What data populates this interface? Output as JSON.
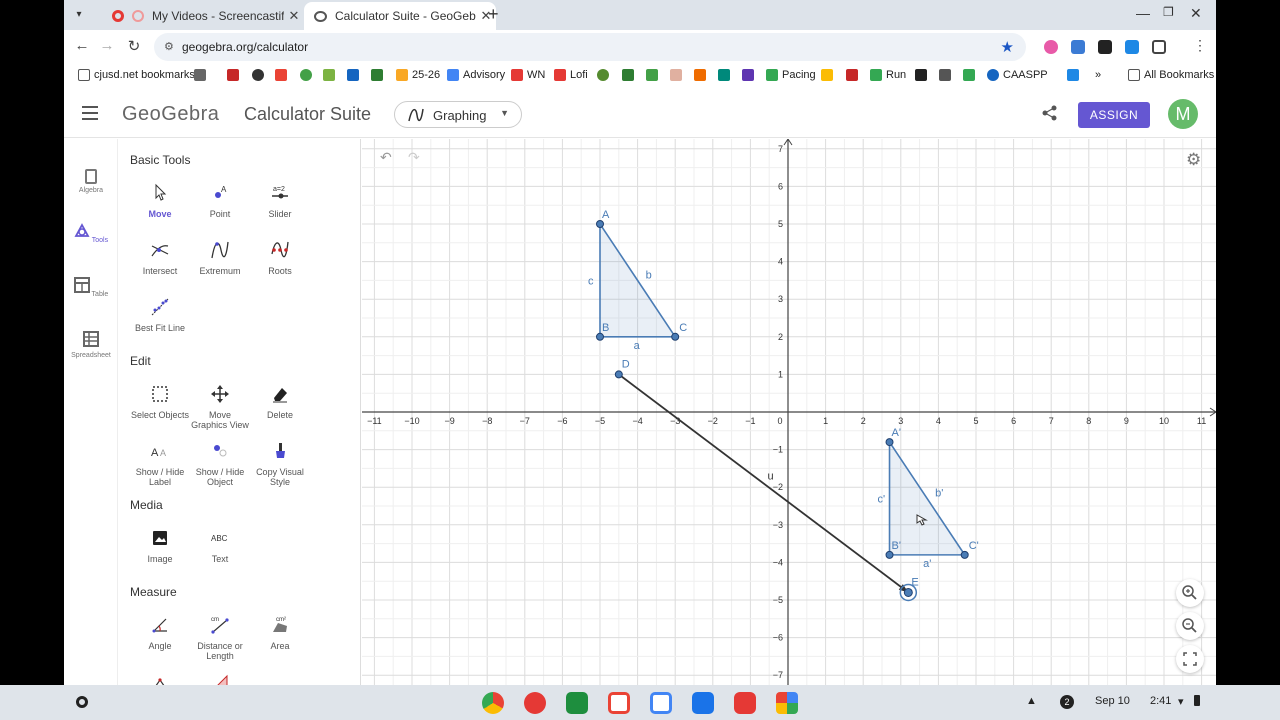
{
  "browser": {
    "tabs": [
      {
        "title": "My Videos - Screencastify",
        "active": false
      },
      {
        "title": "Calculator Suite - GeoGebra",
        "active": true
      }
    ],
    "url": "geogebra.org/calculator",
    "bookmarks": [
      "cjusd.net bookmarks",
      "25-26",
      "Advisory",
      "WN",
      "Lofi",
      "Pacing",
      "Run",
      "CAASPP"
    ],
    "all_bookmarks": "All Bookmarks",
    "overflow": "»"
  },
  "header": {
    "logo": "GeoGebra",
    "suite": "Calculator Suite",
    "app_select": "Graphing",
    "assign": "ASSIGN",
    "avatar": "M",
    "accent": "#6557d2"
  },
  "rail": [
    {
      "label": "Algebra",
      "icon": "calculator-icon",
      "active": false
    },
    {
      "label": "Tools",
      "icon": "tools-icon",
      "active": true
    },
    {
      "label": "Table",
      "icon": "table-icon",
      "active": false
    },
    {
      "label": "Spreadsheet",
      "icon": "spreadsheet-icon",
      "active": false
    }
  ],
  "tools": {
    "basic": {
      "title": "Basic Tools",
      "items": [
        {
          "l1": "Move",
          "l2": "",
          "icon": "move-arrow-icon",
          "selected": true
        },
        {
          "l1": "Point",
          "l2": "",
          "icon": "point-icon"
        },
        {
          "l1": "Slider",
          "l2": "",
          "icon": "slider-icon"
        },
        {
          "l1": "Intersect",
          "l2": "",
          "icon": "intersect-icon"
        },
        {
          "l1": "Extremum",
          "l2": "",
          "icon": "extremum-icon"
        },
        {
          "l1": "Roots",
          "l2": "",
          "icon": "roots-icon"
        },
        {
          "l1": "Best Fit Line",
          "l2": "",
          "icon": "best-fit-line-icon"
        }
      ]
    },
    "edit": {
      "title": "Edit",
      "items": [
        {
          "l1": "Select Objects",
          "l2": "",
          "icon": "select-objects-icon"
        },
        {
          "l1": "Move",
          "l2": "Graphics View",
          "icon": "move-graphics-icon"
        },
        {
          "l1": "Delete",
          "l2": "",
          "icon": "eraser-icon"
        },
        {
          "l1": "Show / Hide",
          "l2": "Label",
          "icon": "label-icon"
        },
        {
          "l1": "Show / Hide",
          "l2": "Object",
          "icon": "show-hide-object-icon"
        },
        {
          "l1": "Copy Visual",
          "l2": "Style",
          "icon": "brush-icon"
        }
      ]
    },
    "media": {
      "title": "Media",
      "items": [
        {
          "l1": "Image",
          "l2": "",
          "icon": "image-icon"
        },
        {
          "l1": "Text",
          "l2": "",
          "icon": "text-abc-icon"
        }
      ]
    },
    "measure": {
      "title": "Measure",
      "items": [
        {
          "l1": "Angle",
          "l2": "",
          "icon": "angle-icon"
        },
        {
          "l1": "Distance or",
          "l2": "Length",
          "icon": "distance-icon"
        },
        {
          "l1": "Area",
          "l2": "",
          "icon": "area-icon"
        }
      ]
    }
  },
  "graph": {
    "x_range": [
      -11,
      11
    ],
    "y_range": [
      -7,
      7
    ],
    "x_ticks": [
      "-11",
      "-10",
      "-9",
      "-8",
      "-7",
      "-6",
      "-5",
      "-4",
      "-3",
      "-2",
      "-1",
      "0",
      "1",
      "2",
      "3",
      "4",
      "5",
      "6",
      "7",
      "8",
      "9",
      "10",
      "11"
    ],
    "y_ticks": [
      "7",
      "6",
      "5",
      "4",
      "3",
      "2",
      "1",
      "-1",
      "-2",
      "-3",
      "-4",
      "-5",
      "-6",
      "-7"
    ],
    "triangle_color": "#4a7cb5",
    "triangle": {
      "vertices": [
        {
          "name": "A",
          "x": -5,
          "y": 5
        },
        {
          "name": "B",
          "x": -5,
          "y": 2
        },
        {
          "name": "C",
          "x": -3,
          "y": 2
        }
      ],
      "sides": [
        {
          "name": "a"
        },
        {
          "name": "b"
        },
        {
          "name": "c"
        }
      ]
    },
    "image_triangle": {
      "vertices": [
        {
          "name": "A'",
          "x": 2.7,
          "y": -0.8
        },
        {
          "name": "B'",
          "x": 2.7,
          "y": -3.8
        },
        {
          "name": "C'",
          "x": 4.7,
          "y": -3.8
        }
      ],
      "sides": [
        {
          "name": "a'"
        },
        {
          "name": "b'"
        },
        {
          "name": "c'"
        }
      ]
    },
    "vector": {
      "name": "u",
      "from": {
        "name": "D",
        "x": -4.5,
        "y": 1
      },
      "to": {
        "name": "E",
        "x": 3.2,
        "y": -4.8
      }
    }
  },
  "shelf": {
    "notifications": "2",
    "date": "Sep 10",
    "time": "2:41"
  }
}
